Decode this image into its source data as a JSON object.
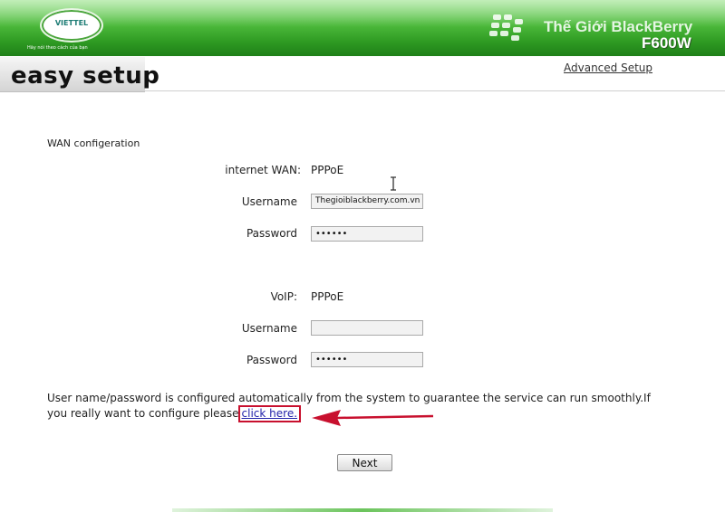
{
  "header": {
    "logo_text": "VIETTEL",
    "slogan": "Hãy nói theo cách của bạn",
    "watermark": "Thế Giới BlackBerry",
    "model": "F600W",
    "colors": {
      "banner": "#3aa62c",
      "accent_red": "#c8102e"
    }
  },
  "page": {
    "title": "easy setup",
    "advanced_link": "Advanced Setup"
  },
  "wan": {
    "section_label": "WAN configeration",
    "internet_wan_label": "internet WAN:",
    "internet_wan_value": "PPPoE",
    "username_label": "Username",
    "username_value": "Thegioiblackberry.com.vn",
    "password_label": "Password",
    "password_value": "••••••"
  },
  "voip": {
    "label": "VoIP:",
    "value": "PPPoE",
    "username_label": "Username",
    "username_value": "",
    "password_label": "Password",
    "password_value": "••••••"
  },
  "notice": {
    "line1": "User name/password is configured automatically from the system to guarantee the service can run smoothly.If",
    "line2_prefix": "you really want to configure please",
    "link_text": "click here."
  },
  "actions": {
    "next_label": "Next"
  },
  "icons": [
    "blackberry-logo-icon",
    "arrow-left-icon",
    "text-cursor-icon"
  ]
}
